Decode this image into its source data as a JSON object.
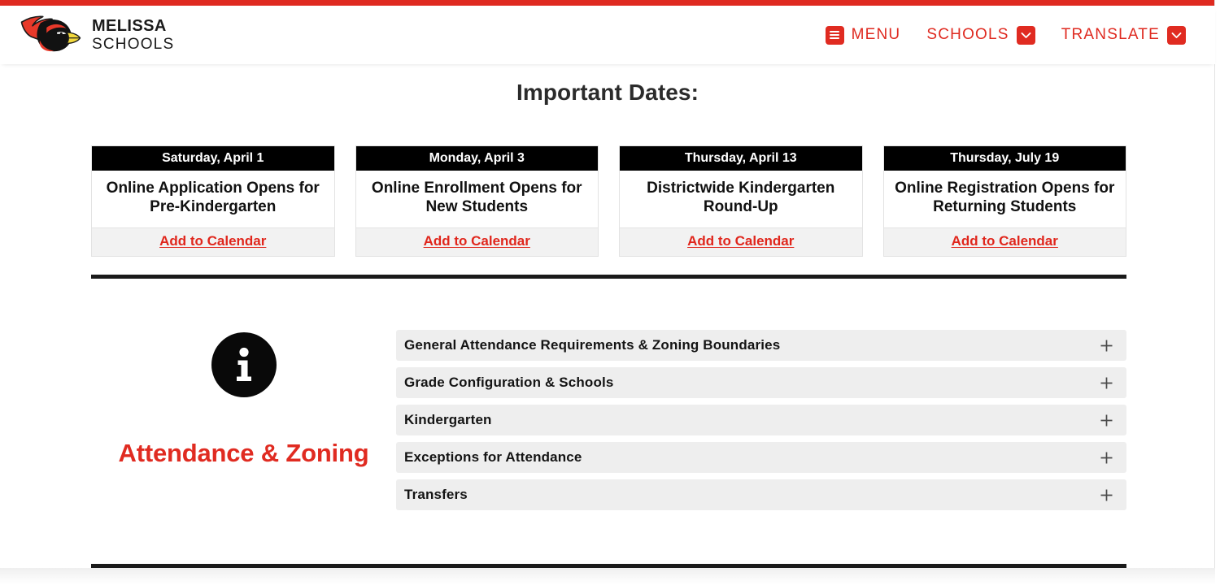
{
  "brand": {
    "logo_icon": "cardinal-mascot-logo",
    "line1": "MELISSA",
    "line2": "SCHOOLS"
  },
  "nav": {
    "items": [
      {
        "label": "MENU",
        "icon": "hamburger-menu-icon"
      },
      {
        "label": "SCHOOLS",
        "icon": "chevron-down-icon"
      },
      {
        "label": "TRANSLATE",
        "icon": "chevron-down-icon"
      }
    ]
  },
  "important_dates": {
    "title": "Important Dates:",
    "cards": [
      {
        "date": "Saturday, April 1",
        "description": "Online Application Opens for Pre-Kindergarten",
        "link": "Add to Calendar"
      },
      {
        "date": "Monday, April 3",
        "description": "Online Enrollment Opens for New Students",
        "link": "Add to Calendar"
      },
      {
        "date": "Thursday, April 13",
        "description": "Districtwide Kindergarten Round-Up",
        "link": "Add to Calendar"
      },
      {
        "date": "Thursday, July 19",
        "description": "Online Registration Opens for Returning Students",
        "link": "Add to Calendar"
      }
    ]
  },
  "attendance_section": {
    "icon": "info-circle-icon",
    "heading": "Attendance & Zoning",
    "accordion": [
      {
        "label": "General Attendance Requirements & Zoning Boundaries",
        "toggle_icon": "plus-icon"
      },
      {
        "label": "Grade Configuration & Schools",
        "toggle_icon": "plus-icon"
      },
      {
        "label": "Kindergarten",
        "toggle_icon": "plus-icon"
      },
      {
        "label": "Exceptions for Attendance",
        "toggle_icon": "plus-icon"
      },
      {
        "label": "Transfers",
        "toggle_icon": "plus-icon"
      }
    ]
  },
  "colors": {
    "brand_red": "#df2a20",
    "link_red": "#e0261c",
    "heading_red": "#e02b21",
    "card_header_bg": "#000000",
    "accordion_bg": "#eeeeee"
  }
}
